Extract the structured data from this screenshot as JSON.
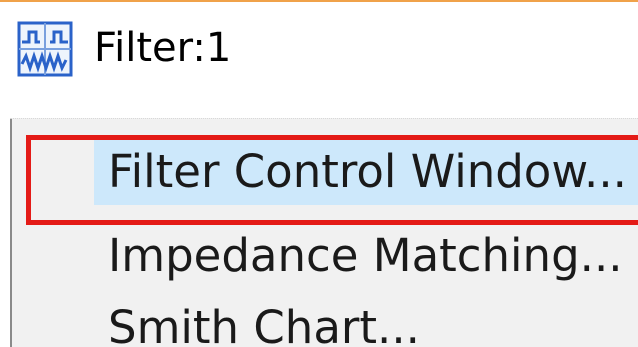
{
  "window": {
    "title": "Filter:1",
    "icon": "filter-waveform-icon"
  },
  "menu": {
    "items": [
      {
        "label": "Filter Control Window...",
        "state": "hovered"
      },
      {
        "label": "Impedance Matching..."
      },
      {
        "label": "Smith Chart..."
      }
    ]
  },
  "annotation": {
    "highlight_color": "#e41b17"
  },
  "colors": {
    "hover_bg": "#cde8fb",
    "menu_bg": "#f1f1f1",
    "icon_accent": "#2a62c9"
  }
}
